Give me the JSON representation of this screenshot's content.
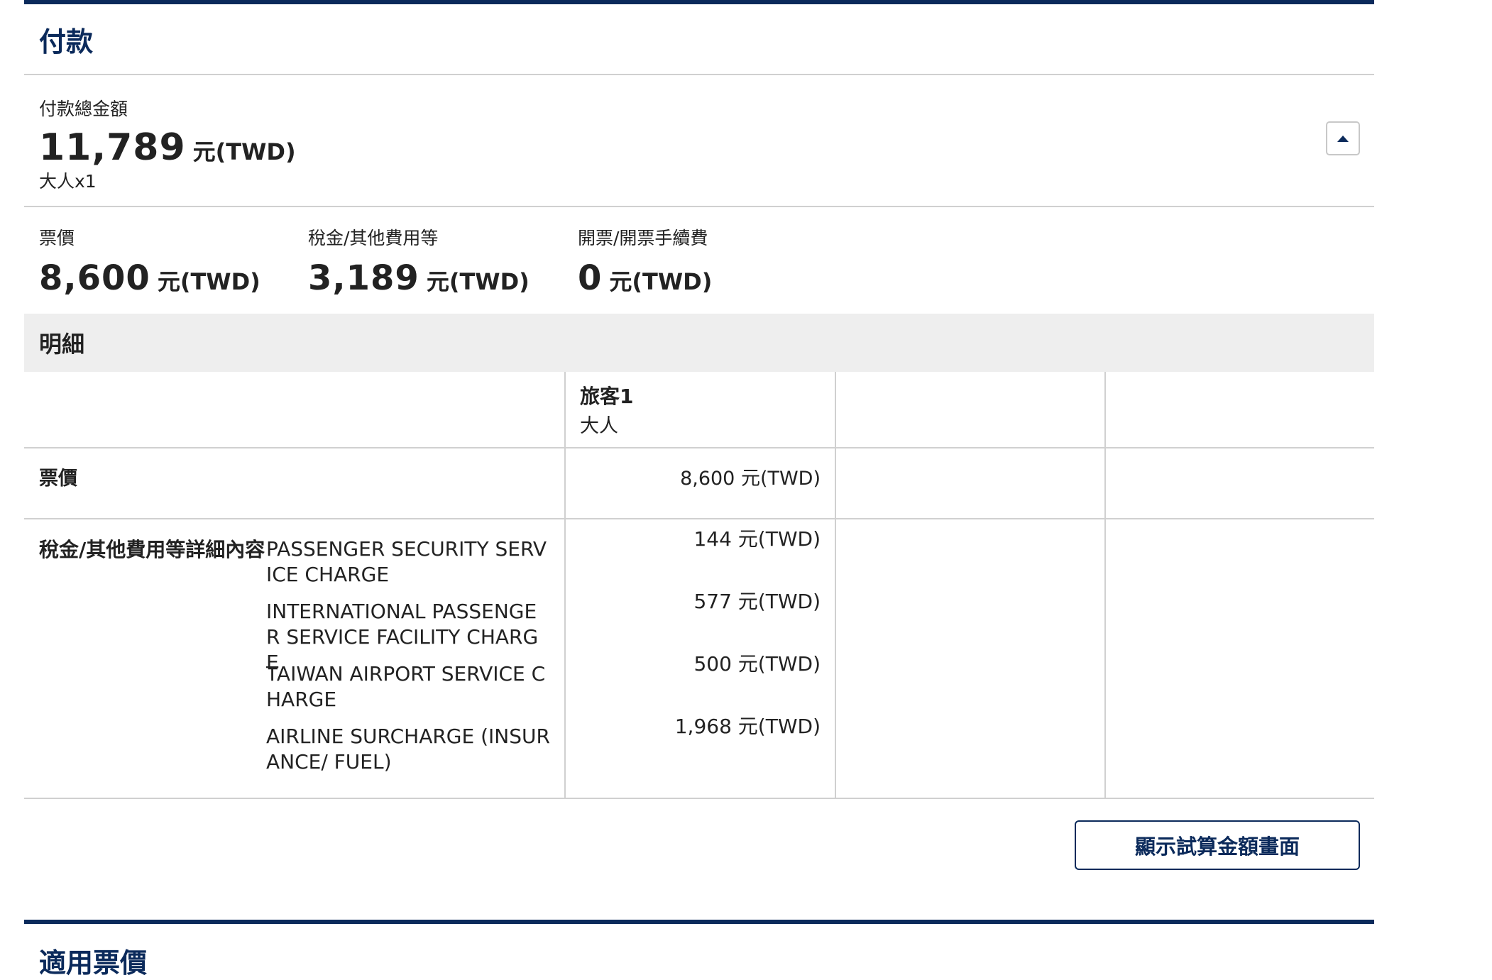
{
  "payment": {
    "title": "付款",
    "total_label": "付款總金額",
    "total_amount": "11,789",
    "currency": "元(TWD)",
    "passengers": "大人x1"
  },
  "breakdown": [
    {
      "label": "票價",
      "value": "8,600",
      "currency": "元(TWD)"
    },
    {
      "label": "稅金/其他費用等",
      "value": "3,189",
      "currency": "元(TWD)"
    },
    {
      "label": "開票/開票手續費",
      "value": "0",
      "currency": "元(TWD)"
    }
  ],
  "details": {
    "title": "明細",
    "passenger_header": {
      "name": "旅客1",
      "type": "大人"
    },
    "fare_label": "票價",
    "fare_value": "8,600 元(TWD)",
    "tax_title": "稅金/其他費用等詳細內容",
    "taxes": [
      {
        "name": "PASSENGER SECURITY SERVICE CHARGE",
        "value": "144 元(TWD)"
      },
      {
        "name": "INTERNATIONAL PASSENGER SERVICE FACILITY CHARGE",
        "value": "577 元(TWD)"
      },
      {
        "name": "TAIWAN AIRPORT SERVICE CHARGE",
        "value": "500 元(TWD)"
      },
      {
        "name": "AIRLINE SURCHARGE (INSURANCE/ FUEL)",
        "value": "1,968 元(TWD)"
      }
    ]
  },
  "buttons": {
    "show_calc": "顯示試算金額畫面"
  },
  "next_section": {
    "title": "適用票價"
  },
  "icons": {
    "collapse": "chevron-up-icon"
  },
  "colors": {
    "brand": "#0b2a5b",
    "divider": "#d0d0d0",
    "header_bg": "#eeeeee"
  }
}
